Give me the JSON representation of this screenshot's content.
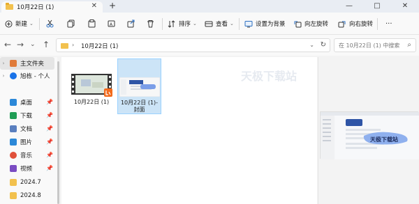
{
  "tab": {
    "title": "10月22日 (1)"
  },
  "window": {
    "minimize": "—",
    "maximize": "□",
    "close": "✕"
  },
  "toolbar": {
    "new_label": "新建",
    "sort_label": "排序",
    "view_label": "查看",
    "set_wallpaper_label": "设置为背景",
    "rotate_left_label": "向左旋转",
    "rotate_right_label": "向右旋转",
    "more_label": "···"
  },
  "address": {
    "crumb": "10月22日 (1)"
  },
  "search": {
    "placeholder": "在 10月22日 (1) 中搜索"
  },
  "sidebar": {
    "items": [
      {
        "label": "主文件夹",
        "icon": "home-icon",
        "color": "#e07b3a"
      },
      {
        "label": "旭栋 - 个人",
        "icon": "onedrive-icon",
        "color": "#1a73e8"
      },
      {
        "label": "桌面",
        "icon": "desktop-icon",
        "color": "#2b88d8"
      },
      {
        "label": "下载",
        "icon": "download-icon",
        "color": "#1f9d55"
      },
      {
        "label": "文档",
        "icon": "documents-icon",
        "color": "#5a7fbf"
      },
      {
        "label": "图片",
        "icon": "pictures-icon",
        "color": "#2b88d8"
      },
      {
        "label": "音乐",
        "icon": "music-icon",
        "color": "#e0503a"
      },
      {
        "label": "视频",
        "icon": "videos-icon",
        "color": "#7a4cc2"
      },
      {
        "label": "2024.7",
        "icon": "folder-icon",
        "color": "#f2c14e"
      },
      {
        "label": "2024.8",
        "icon": "folder-icon",
        "color": "#f2c14e"
      }
    ]
  },
  "files": [
    {
      "name": "10月22日 (1)",
      "type": "video"
    },
    {
      "name": "10月22日 (1)-封面",
      "type": "image"
    }
  ],
  "watermark": "天极下载站",
  "preview": {
    "banner_text": "天极下载站"
  }
}
